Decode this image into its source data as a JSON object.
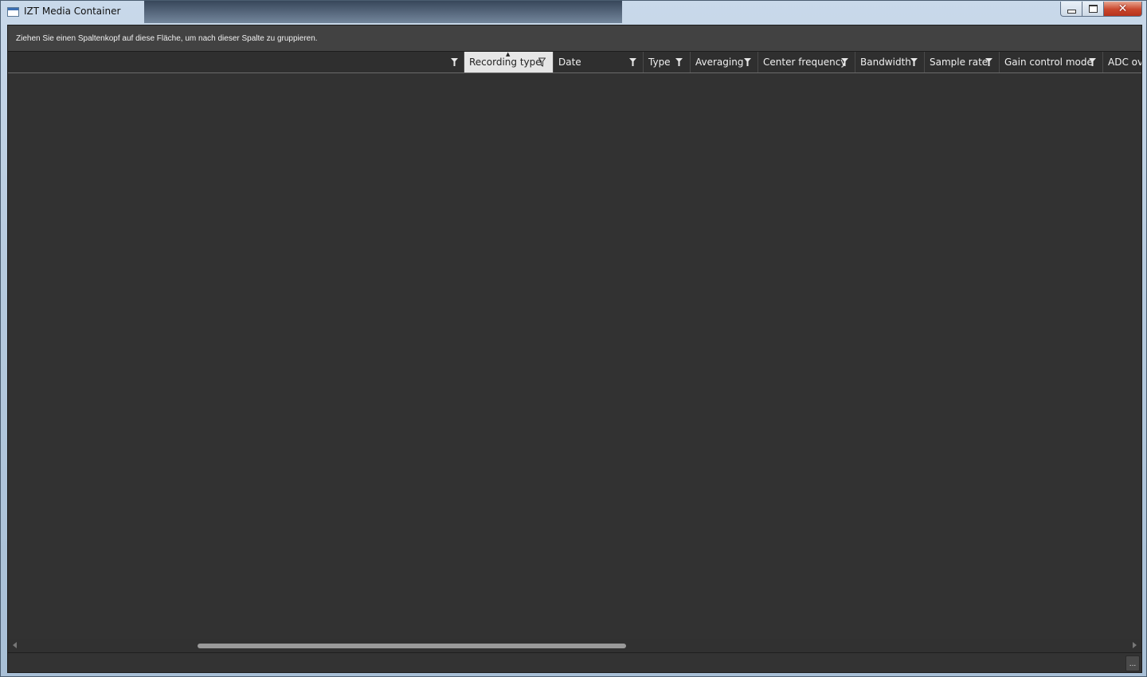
{
  "window": {
    "title": "IZT Media Container",
    "close_glyph": "✕"
  },
  "group_panel": {
    "hint": "Ziehen Sie einen Spaltenkopf auf diese Fläche, um nach dieser Spalte zu gruppieren."
  },
  "grid": {
    "columns": [
      {
        "label": ""
      },
      {
        "label": "Recording type",
        "sorted": "ascending"
      },
      {
        "label": "Date"
      },
      {
        "label": "Type"
      },
      {
        "label": "Averaging"
      },
      {
        "label": "Center frequency"
      },
      {
        "label": "Bandwidth"
      },
      {
        "label": "Sample rate"
      },
      {
        "label": "Gain control mode"
      },
      {
        "label": "ADC ove"
      }
    ],
    "rows": []
  },
  "status_bar": {
    "more_button_label": "..."
  },
  "colors": {
    "grid_background": "#333333",
    "header_background": "#2f2f2f",
    "sorted_header_background": "#e6e6e6",
    "group_panel_background": "#424242"
  },
  "icons": [
    "app-window-icon",
    "filter-icon",
    "sort-ascending-icon",
    "minimize-icon",
    "maximize-icon",
    "close-icon"
  ]
}
